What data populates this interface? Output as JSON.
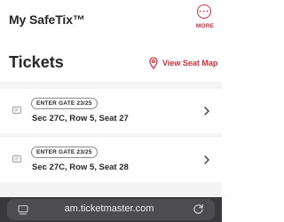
{
  "header": {
    "app_title": "My SafeTix™",
    "more_label": "MORE"
  },
  "tickets_section": {
    "title": "Tickets",
    "seat_map_label": "View Seat Map",
    "icons": {
      "seat_map": "location-pin-icon",
      "ticket": "ticket-icon",
      "chevron": "chevron-right-icon"
    }
  },
  "tickets": [
    {
      "gate": "ENTER GATE 23/25",
      "seat": "Sec 27C, Row 5, Seat 27"
    },
    {
      "gate": "ENTER GATE 23/25",
      "seat": "Sec 27C, Row 5, Seat 28"
    }
  ],
  "browser": {
    "url": "am.ticketmaster.com",
    "icons": {
      "left": "reader-mode-icon",
      "right": "reload-icon"
    }
  },
  "colors": {
    "accent": "#d12e3c",
    "text": "#262626",
    "content_background": "#f4f4f5",
    "browser_bar": "#3a3a3c"
  }
}
